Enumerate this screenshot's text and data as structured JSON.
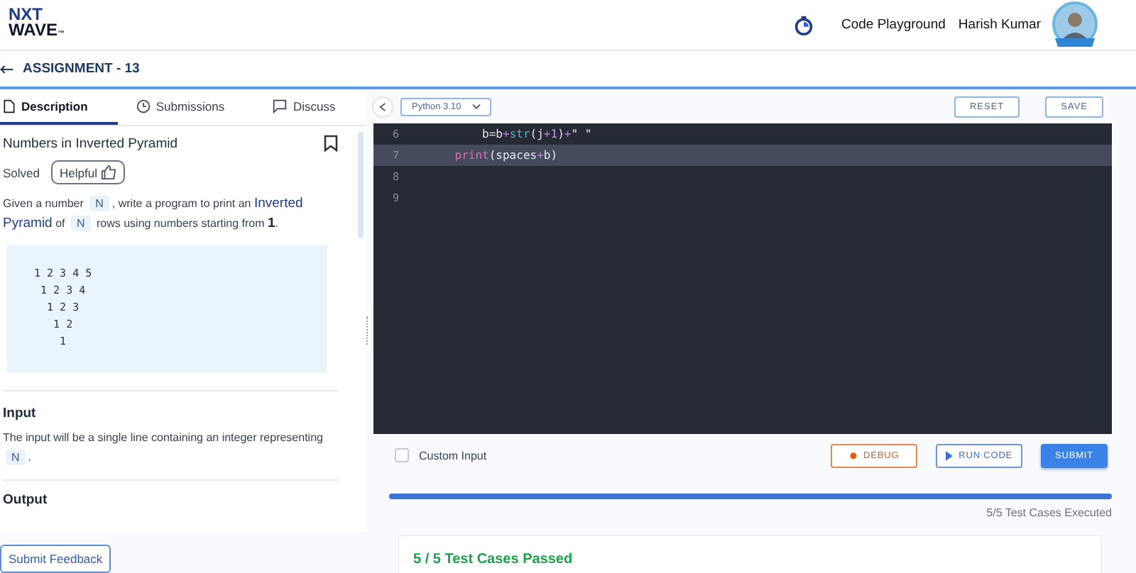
{
  "header": {
    "logo": {
      "line1": "NXT",
      "line2": "WAVE",
      "mark": "™"
    },
    "nav_link": "Code Playground",
    "user_name": "Harish Kumar"
  },
  "assignment": {
    "title": "ASSIGNMENT - 13"
  },
  "tabs": [
    {
      "label": "Description",
      "kind": "document",
      "selected": true
    },
    {
      "label": "Submissions",
      "kind": "clock",
      "selected": false
    },
    {
      "label": "Discuss",
      "kind": "chat",
      "selected": false
    }
  ],
  "problem": {
    "title": "Numbers in Inverted Pyramid",
    "status": "Solved",
    "helpful_label": "Helpful",
    "description": [
      {
        "kind": "text",
        "text": "Given a number "
      },
      {
        "kind": "code",
        "text": "N"
      },
      {
        "kind": "text",
        "text": ", write a program to print an "
      },
      {
        "kind": "highlight",
        "text": "Inverted Pyramid"
      },
      {
        "kind": "text",
        "text": " of "
      },
      {
        "kind": "code",
        "text": "N"
      },
      {
        "kind": "text",
        "text": " rows using numbers starting from "
      },
      {
        "kind": "bold",
        "text": "1"
      },
      {
        "kind": "text",
        "text": "."
      }
    ],
    "example_lines": [
      "1 2 3 4 5",
      " 1 2 3 4",
      "  1 2 3",
      "   1 2",
      "    1"
    ],
    "sections": [
      {
        "heading": "Input",
        "body": [
          {
            "kind": "text",
            "text": "The input will be a single line containing an integer representing "
          },
          {
            "kind": "code",
            "text": "N"
          },
          {
            "kind": "text",
            "text": "."
          }
        ]
      },
      {
        "heading": "Output"
      }
    ]
  },
  "feedback_button": "Submit Feedback",
  "editor": {
    "language": "Python 3.10",
    "buttons": [
      "RESET",
      "SAVE"
    ],
    "lines": [
      {
        "number": "6",
        "highlighted": false,
        "tokens": [
          {
            "kind": "plain",
            "text": "        b=b"
          },
          {
            "kind": "op",
            "text": "+"
          },
          {
            "kind": "func",
            "text": "str"
          },
          {
            "kind": "plain",
            "text": "(j"
          },
          {
            "kind": "op",
            "text": "+"
          },
          {
            "kind": "number",
            "text": "1"
          },
          {
            "kind": "plain",
            "text": ")"
          },
          {
            "kind": "op",
            "text": "+"
          },
          {
            "kind": "string",
            "text": "\" \""
          }
        ]
      },
      {
        "number": "7",
        "highlighted": true,
        "tokens": [
          {
            "kind": "builtin",
            "text": "    print"
          },
          {
            "kind": "plain",
            "text": "(spaces"
          },
          {
            "kind": "op",
            "text": "+"
          },
          {
            "kind": "plain",
            "text": "b)"
          }
        ]
      },
      {
        "number": "8",
        "highlighted": false
      },
      {
        "number": "9",
        "highlighted": false
      }
    ]
  },
  "run_bar": {
    "custom_input": {
      "label": "Custom Input",
      "checked": false
    },
    "debug": "DEBUG",
    "run": "RUN CODE",
    "submit": "SUBMIT"
  },
  "progress": {
    "level": 1.0,
    "caption": "5/5 Test Cases Executed"
  },
  "result": {
    "title": "5 / 5 Test Cases Passed"
  }
}
